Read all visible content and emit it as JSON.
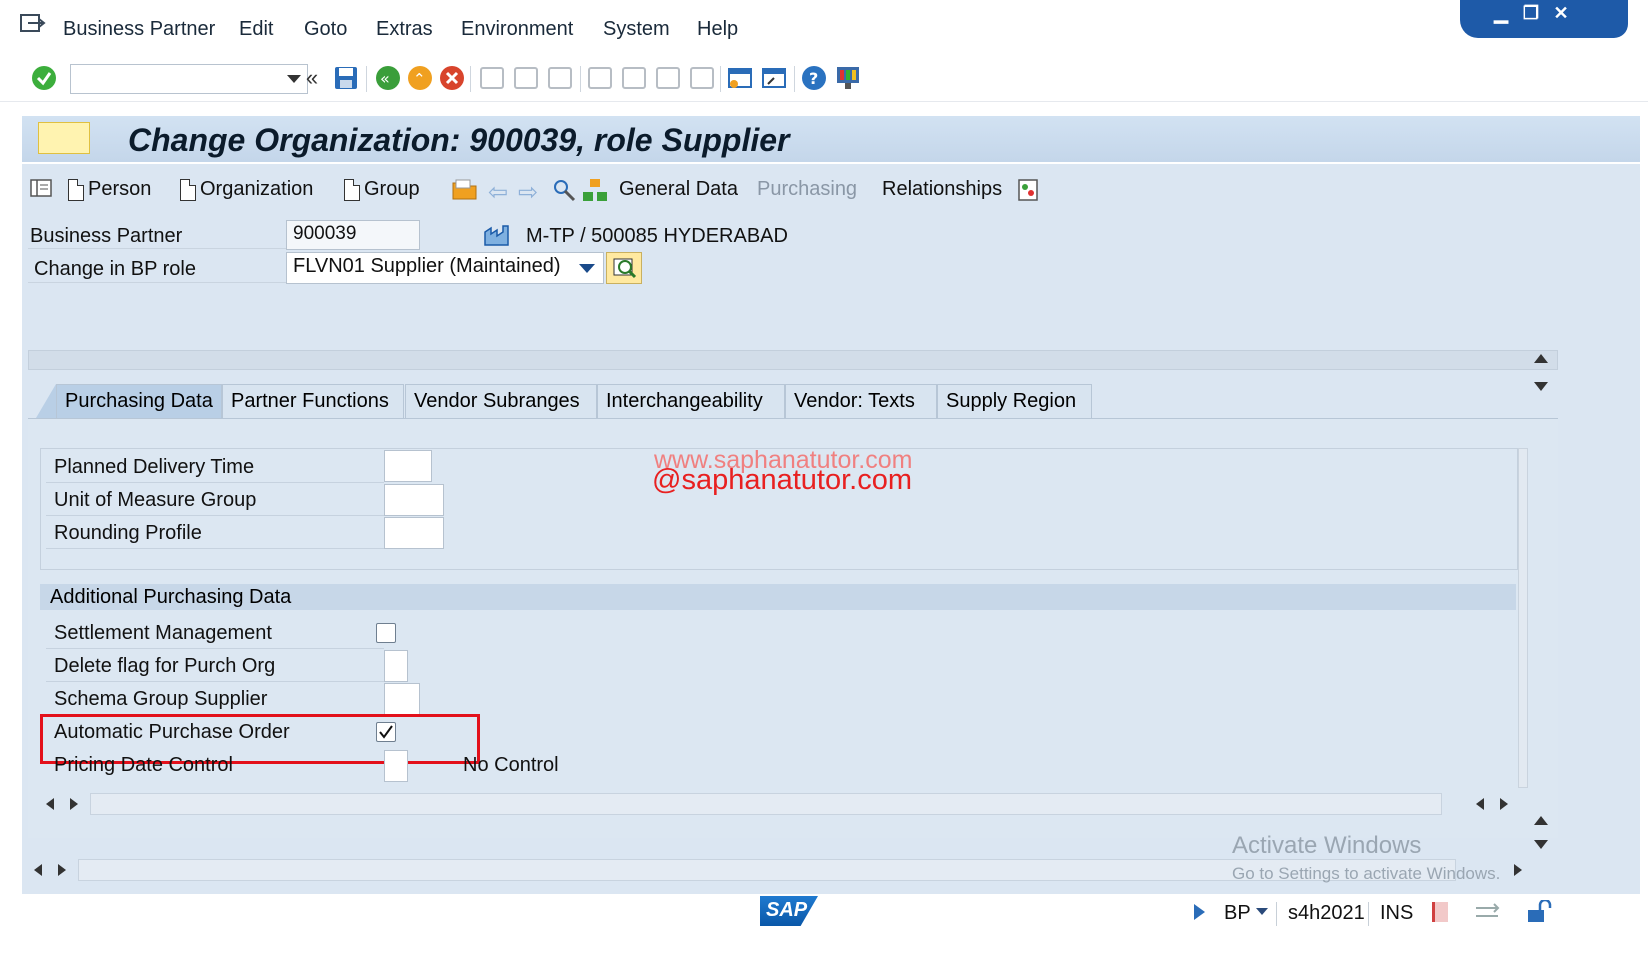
{
  "menu": {
    "items": [
      "Business Partner",
      "Edit",
      "Goto",
      "Extras",
      "Environment",
      "System",
      "Help"
    ]
  },
  "toolbar": {
    "command_value": "",
    "icons": [
      "enter-icon",
      "back-chevrons-icon",
      "save-icon",
      "back-icon",
      "exit-icon",
      "cancel-icon",
      "print-icon",
      "find-icon",
      "find-next-icon",
      "first-page-icon",
      "previous-page-icon",
      "next-page-icon",
      "last-page-icon",
      "new-session-icon",
      "shortcut-icon",
      "help-icon",
      "customize-layout-icon"
    ]
  },
  "title": "Change Organization: 900039, role Supplier",
  "app_toolbar": {
    "person": "Person",
    "organization": "Organization",
    "group": "Group",
    "general_data": "General Data",
    "purchasing": "Purchasing",
    "relationships": "Relationships"
  },
  "header": {
    "bp_label": "Business Partner",
    "bp_value": "900039",
    "bp_description": "M-TP / 500085 HYDERABAD",
    "role_label": "Change in BP role",
    "role_value": "FLVN01 Supplier (Maintained)"
  },
  "tabs": [
    {
      "label": "Purchasing Data",
      "active": true
    },
    {
      "label": "Partner Functions",
      "active": false
    },
    {
      "label": "Vendor Subranges",
      "active": false
    },
    {
      "label": "Interchangeability",
      "active": false
    },
    {
      "label": "Vendor: Texts",
      "active": false
    },
    {
      "label": "Supply Region",
      "active": false
    }
  ],
  "fields": {
    "planned_delivery_time": "Planned Delivery Time",
    "unit_of_measure_group": "Unit of Measure Group",
    "rounding_profile": "Rounding Profile",
    "section_title": "Additional Purchasing Data",
    "settlement_management": "Settlement Management",
    "delete_flag": "Delete flag for Purch Org",
    "schema_group_supplier": "Schema Group Supplier",
    "automatic_purchase_order": "Automatic Purchase Order",
    "automatic_purchase_order_checked": true,
    "settlement_management_checked": false,
    "pricing_date_control": "Pricing Date Control",
    "pricing_date_control_value": "No Control"
  },
  "watermark": {
    "line1": "www.saphanatutor.com",
    "line2": "@saphanatutor.com"
  },
  "windows_notice": {
    "line1": "Activate Windows",
    "line2": "Go to Settings to activate Windows."
  },
  "status": {
    "transaction": "BP",
    "system": "s4h2021",
    "mode": "INS"
  },
  "colors": {
    "highlight": "#e3101b",
    "title_bg": "#c4d6ea",
    "work_bg": "#dbe6f2",
    "watermark": "#e82020"
  }
}
